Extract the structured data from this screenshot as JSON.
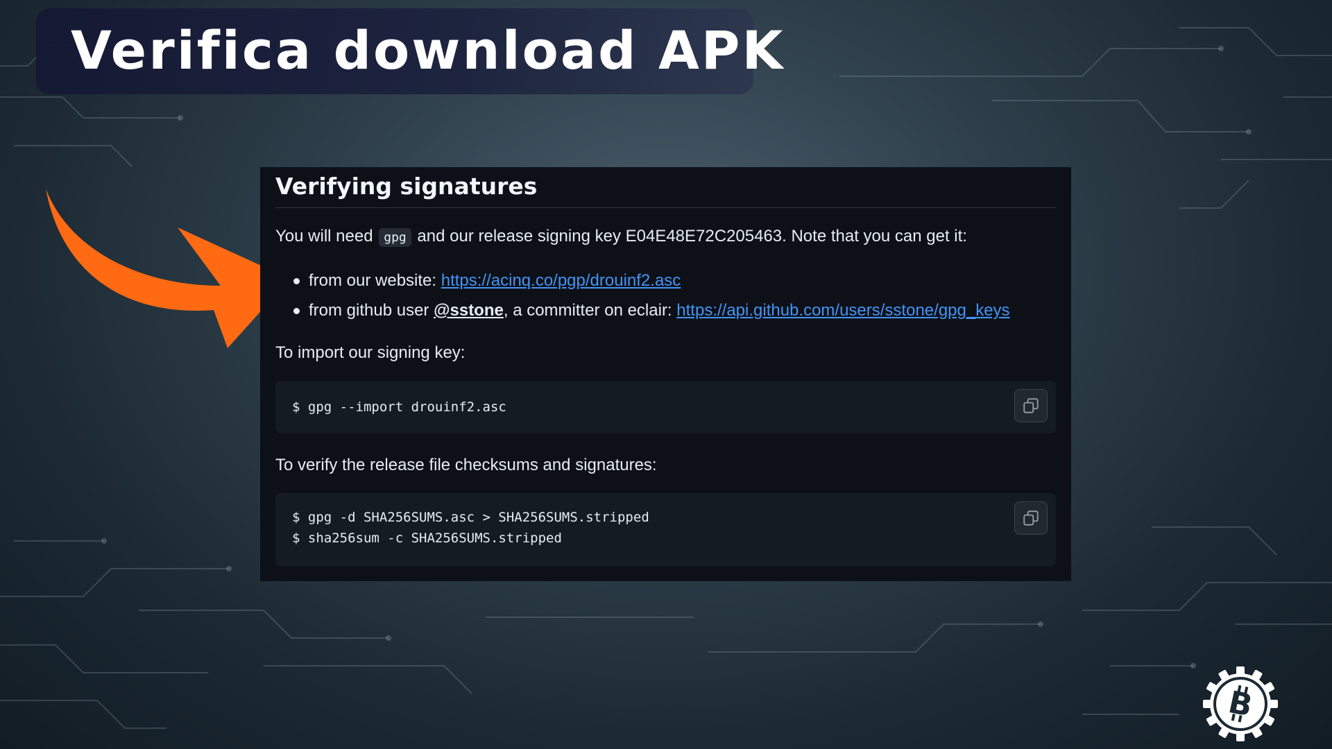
{
  "slide": {
    "title": "Verifica download APK"
  },
  "panel": {
    "heading": "Verifying signatures",
    "intro_before": "You will need",
    "intro_code": "gpg",
    "intro_after": "and our release signing key E04E48E72C205463. Note that you can get it:",
    "bullets": [
      {
        "prefix": "from our website: ",
        "link": "https://acinq.co/pgp/drouinf2.asc"
      },
      {
        "prefix": "from github user ",
        "mention": "@sstone",
        "middle": ", a committer on eclair: ",
        "link": "https://api.github.com/users/sstone/gpg_keys"
      }
    ],
    "import_label": "To import our signing key:",
    "import_code": [
      "$ gpg --import drouinf2.asc"
    ],
    "verify_label": "To verify the release file checksums and signatures:",
    "verify_code": [
      "$ gpg -d SHA256SUMS.asc > SHA256SUMS.stripped",
      "$ sha256sum -c SHA256SUMS.stripped"
    ]
  },
  "icons": {
    "copy": "copy-icon",
    "arrow": "orange-arrow-icon",
    "logo": "bitcoin-gear-logo"
  },
  "colors": {
    "panel_bg": "#0d1117",
    "code_bg": "#151b23",
    "link": "#4493f8",
    "arrow": "#ff6a13",
    "title_bg": "#161a36"
  }
}
